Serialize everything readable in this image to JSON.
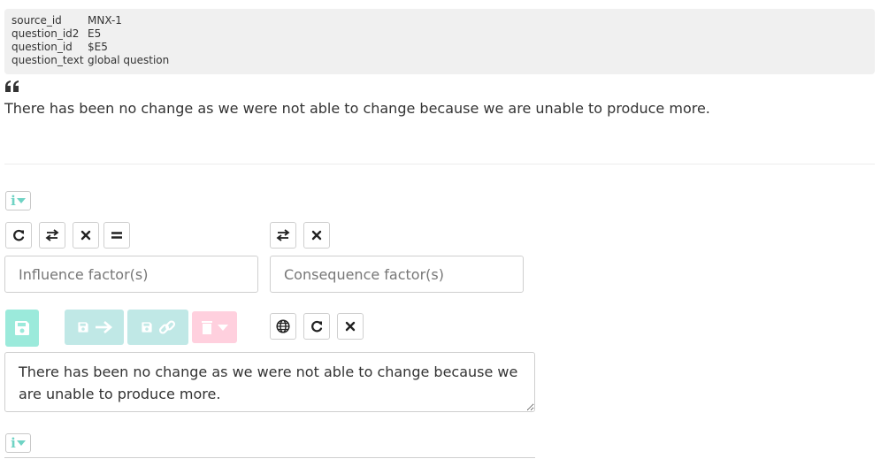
{
  "meta": {
    "rows": [
      {
        "key": "source_id",
        "value": "MNX-1"
      },
      {
        "key": "question_id2",
        "value": "E5"
      },
      {
        "key": "question_id",
        "value": "$E5"
      },
      {
        "key": "question_text",
        "value": "global question"
      }
    ]
  },
  "quote": {
    "text": "There has been no change as we were not able to change because we are unable to produce more."
  },
  "inputs": {
    "influence_placeholder": "Influence factor(s)",
    "consequence_placeholder": "Consequence factor(s)"
  },
  "answer": {
    "text": "There has been no change as we were not able to change because we are unable to produce more."
  },
  "colors": {
    "accent_teal": "#6fd3c4",
    "save_bg": "#9beadb",
    "action_bg": "#c0e8e6",
    "delete_bg": "#ffd0de"
  }
}
